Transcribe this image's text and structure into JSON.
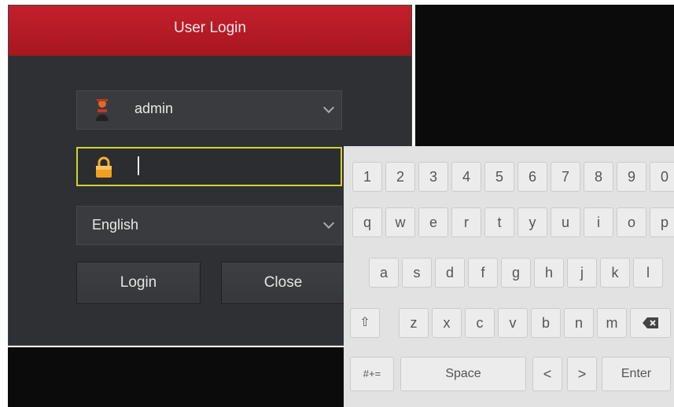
{
  "dialog": {
    "title": "User Login",
    "username": "admin",
    "language": "English",
    "login_label": "Login",
    "close_label": "Close"
  },
  "keyboard": {
    "row1": [
      "1",
      "2",
      "3",
      "4",
      "5",
      "6",
      "7",
      "8",
      "9",
      "0"
    ],
    "row2": [
      "q",
      "w",
      "e",
      "r",
      "t",
      "y",
      "u",
      "i",
      "o",
      "p"
    ],
    "row3": [
      "a",
      "s",
      "d",
      "f",
      "g",
      "h",
      "j",
      "k",
      "l"
    ],
    "row4": [
      "z",
      "x",
      "c",
      "v",
      "b",
      "n",
      "m"
    ],
    "shift_symbol": "⇧",
    "symbols_label": "#+=",
    "space_label": "Space",
    "left_label": "<",
    "right_label": ">",
    "enter_label": "Enter"
  },
  "colors": {
    "title_red": "#b91c26",
    "focus_yellow": "#cfd233",
    "dialog_bg": "#2e3033"
  }
}
